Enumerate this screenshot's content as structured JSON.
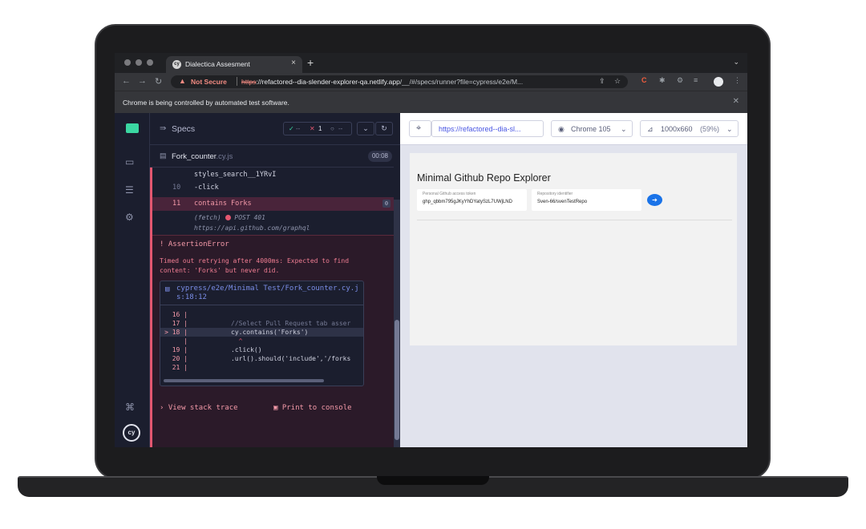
{
  "browser": {
    "tab_title": "Dialectica Assesment",
    "tab_favicon": "cy",
    "tab_close": "×",
    "new_tab": "+",
    "not_secure": "Not Secure",
    "url_scheme": "https",
    "url_host": "://refactored--dia-slender-explorer-qa.netlify.app",
    "url_path": "/__/#/specs/runner?file=cypress/e2e/M...",
    "automation_banner": "Chrome is being controlled by automated test software."
  },
  "reporter": {
    "specs_label": "Specs",
    "stats": {
      "passed": "--",
      "failed": "1",
      "pending": "--"
    },
    "file_name": "Fork_counter",
    "file_ext": ".cy.js",
    "duration": "00:08",
    "commands": [
      {
        "num": "",
        "text": "styles_search__1YRvI"
      },
      {
        "num": "10",
        "text": "-click"
      },
      {
        "num": "11",
        "text": "contains  Forks",
        "badge": "0"
      }
    ],
    "fetch_method": "(fetch)",
    "fetch_status": "POST 401",
    "fetch_url": "https://api.github.com/graphql",
    "error": {
      "title": "! AssertionError",
      "message": "Timed out retrying after 4000ms: Expected to find content: 'Forks' but never did.",
      "file_path": "cypress/e2e/Minimal Test/Fork_counter.cy.js:18:12",
      "code_lines": [
        {
          "ln": "16 |",
          "code": ""
        },
        {
          "ln": "17 |",
          "code": "//Select Pull Request tab asser"
        },
        {
          "ln": "> 18 |",
          "code": "cy.contains('Forks')"
        },
        {
          "ln": "|",
          "code": "  ^"
        },
        {
          "ln": "19 |",
          "code": ".click()"
        },
        {
          "ln": "20 |",
          "code": ".url().should('include','/forks"
        },
        {
          "ln": "21 |",
          "code": ""
        }
      ],
      "view_stack_trace": "View stack trace",
      "print_to_console": "Print to console"
    }
  },
  "aut": {
    "url": "https://refactored--dia-sl...",
    "browser": "Chrome 105",
    "viewport": "1000x660",
    "viewport_pct": "(59%)",
    "app": {
      "title": "Minimal Github Repo Explorer",
      "token_label": "Personal Github access token",
      "token_value": "ghp_qbbm795gJKyYhDYatySzL7UWjLND",
      "repo_label": "Repository identifier",
      "repo_value": "Sven-66/svenTestRepo"
    }
  },
  "colors": {
    "cypress_bg": "#1b1e2e",
    "error_red": "#e45770",
    "accent_blue": "#1a73e8"
  },
  "icons": [
    "search-icon",
    "chrome-icon",
    "viewport-icon",
    "gear-icon",
    "keyboard-shortcuts-icon",
    "cypress-logo"
  ]
}
